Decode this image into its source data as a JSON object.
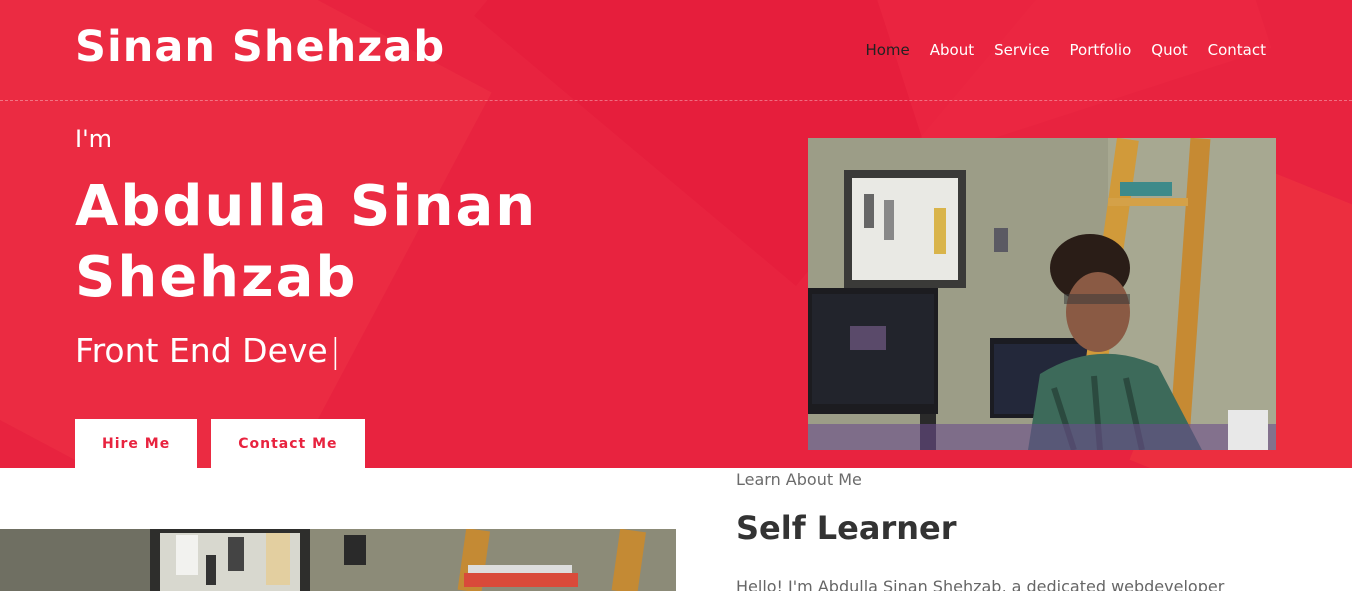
{
  "header": {
    "brand": "Sinan Shehzab",
    "nav": [
      "Home",
      "About",
      "Service",
      "Portfolio",
      "Quot",
      "Contact"
    ],
    "active_index": 0
  },
  "hero": {
    "greeting": "I'm",
    "name": "Abdulla Sinan Shehzab",
    "role": "Front End Deve",
    "cursor": "|",
    "buttons": {
      "hire": "Hire Me",
      "contact": "Contact Me"
    }
  },
  "about": {
    "kicker": "Learn About Me",
    "title": "Self Learner",
    "body": "Hello! I'm Abdulla Sinan Shehzab, a dedicated webdeveloper"
  },
  "colors": {
    "accent": "#e8233f",
    "text_light": "#ffffff",
    "text_dark": "#333333"
  }
}
